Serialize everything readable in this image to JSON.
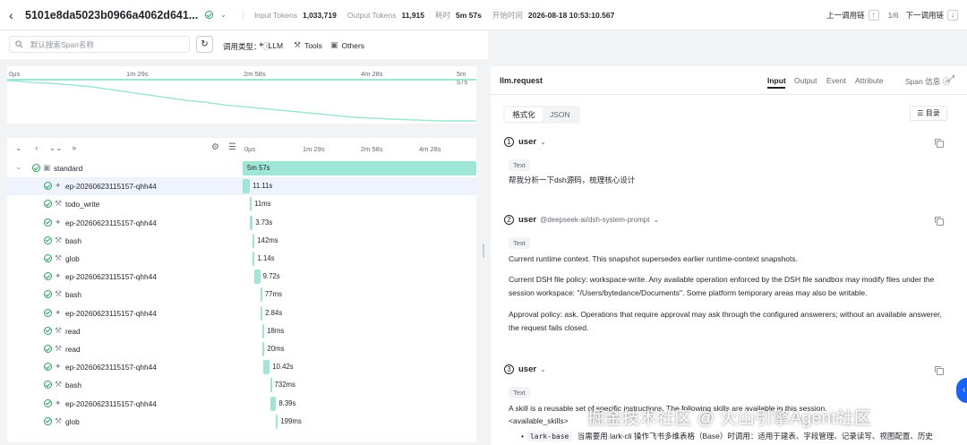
{
  "header": {
    "trace_id": "5101e8da5023b0966a4062d641...",
    "input_tokens_label": "Input Tokens",
    "input_tokens": "1,033,719",
    "output_tokens_label": "Output Tokens",
    "output_tokens": "11,915",
    "duration_label": "耗时",
    "duration": "5m 57s",
    "start_label": "开始时间",
    "start_time": "2026-08-18 10:53:10.567",
    "prev_label": "上一调用链",
    "page": "1/6",
    "next_label": "下一调用链"
  },
  "search": {
    "placeholder": "默认搜索Span名称"
  },
  "filters": {
    "type_label": "调用类型：",
    "llm": "LLM",
    "tools": "Tools",
    "others": "Others"
  },
  "overview_ticks": [
    "0μs",
    "1m 29s",
    "2m 58s",
    "4m 28s",
    "5m 57s"
  ],
  "tree_ticks": [
    "0μs",
    "1m 29s",
    "2m 58s",
    "4m 28s"
  ],
  "tree_controls": {
    "collapse": "⌄",
    "expand": "›",
    "collapse_all": "⌄⌄",
    "expand_all": "»"
  },
  "spans": [
    {
      "name": "standard",
      "type": "root",
      "duration": "5m 57s",
      "start": 0.0,
      "fraction": 1.0,
      "indent": 0
    },
    {
      "name": "ep-20260623115157-qhh44",
      "type": "llm",
      "duration": "11.11s",
      "start": 0.0,
      "fraction": 0.031,
      "indent": 1,
      "selected": true
    },
    {
      "name": "todo_write",
      "type": "tool",
      "duration": "11ms",
      "start": 0.031,
      "fraction": 0.001,
      "indent": 1
    },
    {
      "name": "ep-20260623115157-qhh44",
      "type": "llm",
      "duration": "3.73s",
      "start": 0.032,
      "fraction": 0.011,
      "indent": 1
    },
    {
      "name": "bash",
      "type": "tool",
      "duration": "142ms",
      "start": 0.043,
      "fraction": 0.001,
      "indent": 1
    },
    {
      "name": "glob",
      "type": "tool",
      "duration": "1.14s",
      "start": 0.044,
      "fraction": 0.004,
      "indent": 1
    },
    {
      "name": "ep-20260623115157-qhh44",
      "type": "llm",
      "duration": "9.72s",
      "start": 0.048,
      "fraction": 0.027,
      "indent": 1
    },
    {
      "name": "bash",
      "type": "tool",
      "duration": "77ms",
      "start": 0.076,
      "fraction": 0.001,
      "indent": 1
    },
    {
      "name": "ep-20260623115157-qhh44",
      "type": "llm",
      "duration": "2.84s",
      "start": 0.077,
      "fraction": 0.008,
      "indent": 1
    },
    {
      "name": "read",
      "type": "tool",
      "duration": "18ms",
      "start": 0.085,
      "fraction": 0.001,
      "indent": 1
    },
    {
      "name": "read",
      "type": "tool",
      "duration": "20ms",
      "start": 0.086,
      "fraction": 0.001,
      "indent": 1
    },
    {
      "name": "ep-20260623115157-qhh44",
      "type": "llm",
      "duration": "10.42s",
      "start": 0.087,
      "fraction": 0.029,
      "indent": 1
    },
    {
      "name": "bash",
      "type": "tool",
      "duration": "732ms",
      "start": 0.117,
      "fraction": 0.002,
      "indent": 1
    },
    {
      "name": "ep-20260623115157-qhh44",
      "type": "llm",
      "duration": "8.39s",
      "start": 0.119,
      "fraction": 0.024,
      "indent": 1
    },
    {
      "name": "glob",
      "type": "tool",
      "duration": "199ms",
      "start": 0.143,
      "fraction": 0.001,
      "indent": 1
    }
  ],
  "detail": {
    "title": "llm.request",
    "tabs": [
      "Input",
      "Output",
      "Event",
      "Attribute"
    ],
    "active_tab": "Input",
    "span_info": "Span 信息",
    "format_tabs": [
      "格式化",
      "JSON"
    ],
    "toc_label": "目录",
    "messages": [
      {
        "num": "1",
        "role": "user",
        "tag": "",
        "kind": "Text",
        "lines": [
          "帮我分析一下dsh源码，梳理核心设计"
        ]
      },
      {
        "num": "2",
        "role": "user",
        "tag": "@deepseek-ai/dsh-system-prompt",
        "kind": "Text",
        "lines": [
          "Current runtime context. This snapshot supersedes earlier runtime-context snapshots.",
          "Current DSH file policy: workspace-write. Any available operation enforced by the DSH file sandbox may modify files under the session workspace: \"/Users/bytedance/Documents\". Some platform temporary areas may also be writable.",
          "Approval policy: ask. Operations that require approval may ask through the configured answerers; without an available answerer, the request fails closed."
        ]
      },
      {
        "num": "3",
        "role": "user",
        "tag": "",
        "kind": "Text",
        "lines": [
          "A skill is a reusable set of specific instructions. The following skills are available in this session.",
          "<available_skills>"
        ]
      }
    ],
    "skill_item": "lark-base",
    "skill_desc": "当需要用 lark-cli 操作飞书多维表格（Base）时调用：适用于建表、字段管理、记录读写、视图配置、历史"
  },
  "watermark": "掘金技术社区 @ 火山引擎Agent社区",
  "colors": {
    "bar": "#9ee6d6",
    "selected_row": "#eef3fd",
    "ok": "#26a65b",
    "accent": "#1664ff"
  }
}
